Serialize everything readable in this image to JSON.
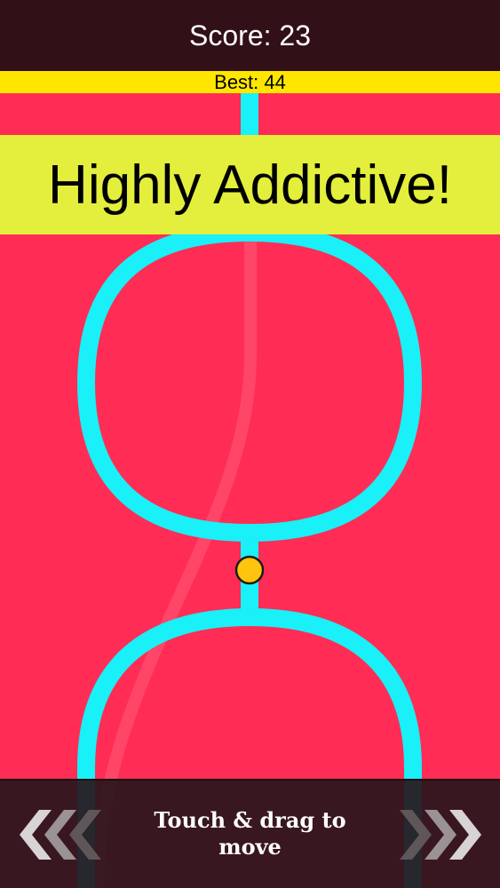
{
  "hud": {
    "score_text": "Score: 23",
    "best_text": "Best: 44"
  },
  "promo": {
    "banner_text": "Highly Addictive!"
  },
  "controls": {
    "hint_line1": "Touch & drag to",
    "hint_line2": "move",
    "left_arrows_icon": "triple-chevron-left-icon",
    "right_arrows_icon": "triple-chevron-right-icon"
  },
  "colors": {
    "background": "#ff2d55",
    "track": "#19f0f8",
    "player_ball": "#ffc40d",
    "score_bar": "#321018",
    "best_bar": "#ffe600",
    "promo_banner": "#e3ef3c"
  }
}
